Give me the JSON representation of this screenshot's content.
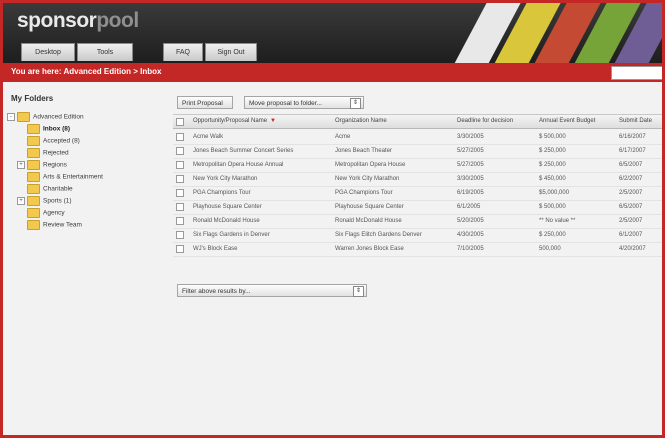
{
  "app": {
    "logo_main": "sponsor",
    "logo_sub": "pool"
  },
  "nav": {
    "tabs": [
      "Desktop",
      "Tools",
      "FAQ",
      "Sign Out"
    ]
  },
  "breadcrumb": {
    "text": "You are here: Advanced Edition > Inbox"
  },
  "sidebar": {
    "title": "My Folders",
    "folders": [
      {
        "label": "Advanced Edition",
        "expander": "-"
      },
      {
        "label": "Inbox (8)",
        "expander": ""
      },
      {
        "label": "Accepted (8)",
        "expander": ""
      },
      {
        "label": "Rejected",
        "expander": ""
      },
      {
        "label": "Regions",
        "expander": "+"
      },
      {
        "label": "Arts & Entertainment",
        "expander": ""
      },
      {
        "label": "Charitable",
        "expander": ""
      },
      {
        "label": "Sports (1)",
        "expander": "+"
      },
      {
        "label": "Agency",
        "expander": ""
      },
      {
        "label": "Review Team",
        "expander": ""
      }
    ]
  },
  "toolbar": {
    "print_label": "Print Proposal",
    "move_label": "Move proposal to folder..."
  },
  "filter": {
    "label": "Filter above results by..."
  },
  "table": {
    "columns": [
      "Opportunity/Proposal Name",
      "Organization Name",
      "Deadline for decision",
      "Annual Event Budget",
      "Submit Date"
    ],
    "rows": [
      [
        "Acme Walk",
        "Acme",
        "3/30/2005",
        "$ 500,000",
        "6/16/2007"
      ],
      [
        "Jones Beach Summer Concert Series",
        "Jones Beach Theater",
        "5/27/2005",
        "$ 250,000",
        "6/17/2007"
      ],
      [
        "Metropolitan Opera House Annual",
        "Metropolitan Opera House",
        "5/27/2005",
        "$ 250,000",
        "6/5/2007"
      ],
      [
        "New York City Marathon",
        "New York City Marathon",
        "3/30/2005",
        "$ 450,000",
        "6/2/2007"
      ],
      [
        "PGA Champions Tour",
        "PGA Champions Tour",
        "6/19/2005",
        "$5,000,000",
        "2/5/2007"
      ],
      [
        "Playhouse Square Center",
        "Playhouse Square Center",
        "6/1/2005",
        "$ 500,000",
        "6/5/2007"
      ],
      [
        "Ronald McDonald House",
        "Ronald McDonald House",
        "5/20/2005",
        "** No value **",
        "2/5/2007"
      ],
      [
        "Six Flags Gardens in Denver",
        "Six Flags Elitch Gardens Denver",
        "4/30/2005",
        "$ 250,000",
        "6/1/2007"
      ],
      [
        "WJ's Block Ease",
        "Warren Jones Block Ease",
        "7/10/2005",
        "500,000",
        "4/20/2007"
      ]
    ]
  },
  "colors": {
    "accent": "#c42826",
    "stripes": [
      "#e8e8e8",
      "#d9c63a",
      "#c44a34",
      "#76a438",
      "#6f5d96"
    ]
  }
}
